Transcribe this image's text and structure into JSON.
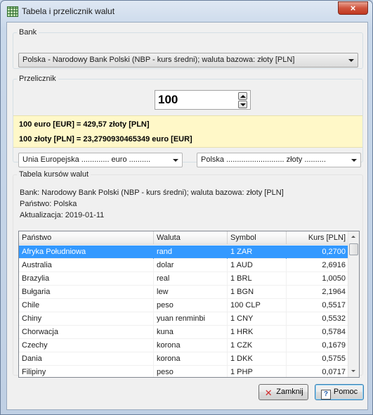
{
  "window": {
    "title": "Tabela i przelicznik walut",
    "close_glyph": "×"
  },
  "bank": {
    "legend": "Bank",
    "selected": "Polska - Narodowy Bank Polski (NBP - kurs średni); waluta bazowa: złoty [PLN]"
  },
  "converter": {
    "legend": "Przelicznik",
    "amount": "100",
    "result_line_1": "100 euro [EUR] = 429,57 złoty [PLN]",
    "result_line_2": "100 złoty [PLN] = 23,2790930465349 euro [EUR]",
    "from_currency": "Unia Europejska ............. euro ..........",
    "to_currency": "Polska ........................... złoty .........."
  },
  "rates_table": {
    "legend": "Tabela kursów walut",
    "bank_line": "Bank: Narodowy Bank Polski (NBP - kurs średni); waluta bazowa: złoty [PLN]",
    "country_line": "Państwo: Polska",
    "update_line": "Aktualizacja: 2019-01-11",
    "columns": [
      "Państwo",
      "Waluta",
      "Symbol",
      "Kurs [PLN]"
    ],
    "rows": [
      [
        "Afryka Południowa",
        "rand",
        "1 ZAR",
        "0,2700"
      ],
      [
        "Australia",
        "dolar",
        "1 AUD",
        "2,6916"
      ],
      [
        "Brazylia",
        "real",
        "1 BRL",
        "1,0050"
      ],
      [
        "Bułgaria",
        "lew",
        "1 BGN",
        "2,1964"
      ],
      [
        "Chile",
        "peso",
        "100 CLP",
        "0,5517"
      ],
      [
        "Chiny",
        "yuan renminbi",
        "1 CNY",
        "0,5532"
      ],
      [
        "Chorwacja",
        "kuna",
        "1 HRK",
        "0,5784"
      ],
      [
        "Czechy",
        "korona",
        "1 CZK",
        "0,1679"
      ],
      [
        "Dania",
        "korona",
        "1 DKK",
        "0,5755"
      ],
      [
        "Filipiny",
        "peso",
        "1 PHP",
        "0,0717"
      ]
    ],
    "selected_row": 0
  },
  "buttons": {
    "close_label": "Zamknij",
    "help_label": "Pomoc"
  }
}
